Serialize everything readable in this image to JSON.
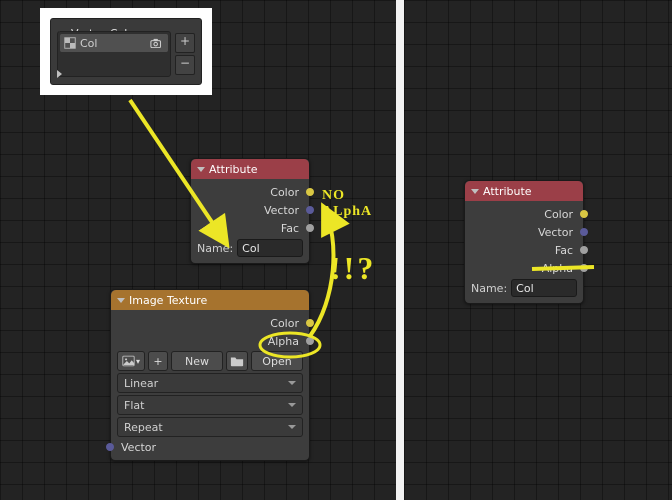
{
  "annotation": {
    "no_alpha_text": "NO ALphA",
    "exclaim_text": "!!?",
    "stroke_color": "#ece626"
  },
  "vertex_colors_panel": {
    "title": "Vertex Colors",
    "items": [
      {
        "name": "Col",
        "render_active": true
      }
    ],
    "add_tooltip": "+",
    "remove_tooltip": "−"
  },
  "attribute_node_left": {
    "title": "Attribute",
    "outputs": [
      "Color",
      "Vector",
      "Fac"
    ],
    "name_label": "Name:",
    "name_value": "Col"
  },
  "attribute_node_right": {
    "title": "Attribute",
    "outputs": [
      "Color",
      "Vector",
      "Fac",
      "Alpha"
    ],
    "name_label": "Name:",
    "name_value": "Col"
  },
  "image_texture_node": {
    "title": "Image Texture",
    "outputs": [
      "Color",
      "Alpha"
    ],
    "new_button": "New",
    "open_button": "Open",
    "interpolation": "Linear",
    "projection": "Flat",
    "extension": "Repeat",
    "vector_input": "Vector"
  }
}
